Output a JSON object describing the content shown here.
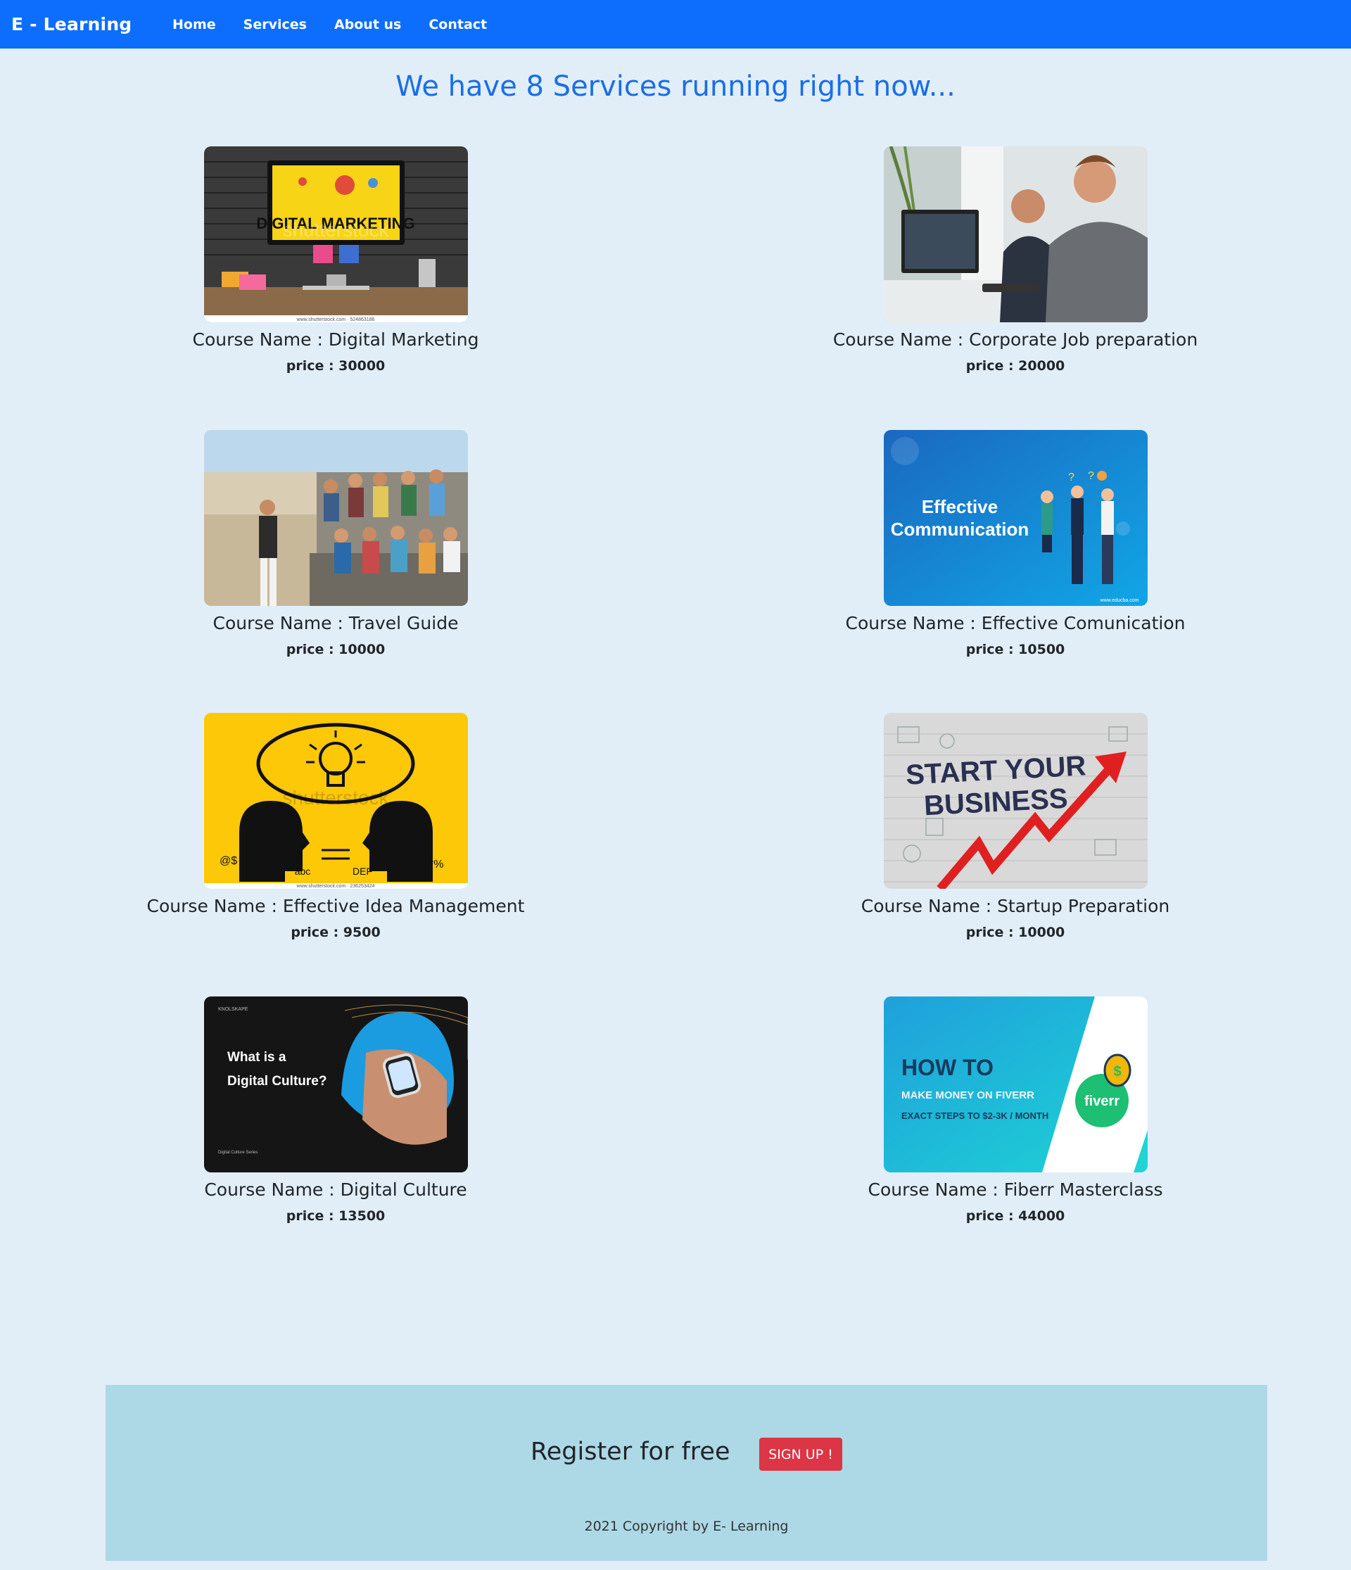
{
  "navbar": {
    "brand": "E - Learning",
    "links": [
      "Home",
      "Services",
      "About us",
      "Contact"
    ]
  },
  "main": {
    "title": "We have 8 Services running right now..."
  },
  "courses": [
    {
      "name": "Course Name : Digital Marketing",
      "price": "price : 30000"
    },
    {
      "name": "Course Name : Corporate Job preparation",
      "price": "price : 20000"
    },
    {
      "name": "Course Name : Travel Guide",
      "price": "price : 10000"
    },
    {
      "name": "Course Name : Effective Comunication",
      "price": "price : 10500"
    },
    {
      "name": "Course Name : Effective Idea Management",
      "price": "price : 9500"
    },
    {
      "name": "Course Name : Startup Preparation",
      "price": "price : 10000"
    },
    {
      "name": "Course Name : Digital Culture",
      "price": "price : 13500"
    },
    {
      "name": "Course Name : Fiberr Masterclass",
      "price": "price : 44000"
    }
  ],
  "thumbnails": {
    "digital_marketing": {
      "text": "DIGITAL MARKETING",
      "watermark": "shutterstock",
      "credit": "www.shutterstock.com · 524863186"
    },
    "effective_communication": {
      "line1": "Effective",
      "line2": "Communication",
      "credit": "www.educba.com"
    },
    "idea_management": {
      "watermark": "shutterstock",
      "left_text": "abc",
      "right_text": "DEF",
      "credit": "www.shutterstock.com · 236253424"
    },
    "startup": {
      "line1": "START YOUR",
      "line2": "BUSINESS"
    },
    "digital_culture": {
      "brand": "KNOLSKAPE",
      "line1": "What is a",
      "line2": "Digital Culture?",
      "series": "Digital Culture Series"
    },
    "fiverr": {
      "line1": "HOW TO",
      "line2": "MAKE MONEY ON FIVERR",
      "line3": "EXACT STEPS TO $2-3K / MONTH",
      "logo": "fiverr"
    }
  },
  "footer": {
    "register": "Register for free",
    "signup": "SIGN UP !",
    "copyright": "2021 Copyright by E- Learning"
  },
  "colors": {
    "primary": "#0d6efd",
    "page_bg": "#e1eef7",
    "title": "#1a6ee8",
    "footer_bg": "#add8e6",
    "danger": "#dc3545"
  }
}
